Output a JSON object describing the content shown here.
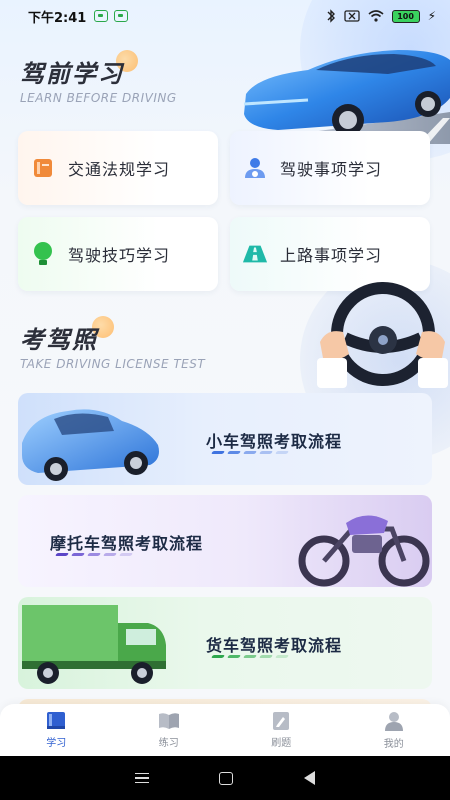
{
  "status_bar": {
    "time": "下午2:41",
    "battery": "100"
  },
  "learn_section": {
    "title": "驾前学习",
    "subtitle": "LEARN BEFORE DRIVING",
    "items": [
      {
        "label": "交通法规学习",
        "icon": "book-icon",
        "color": "#f08a3a"
      },
      {
        "label": "驾驶事项学习",
        "icon": "driver-icon",
        "color": "#3f7be8"
      },
      {
        "label": "驾驶技巧学习",
        "icon": "bulb-icon",
        "color": "#34c24e"
      },
      {
        "label": "上路事项学习",
        "icon": "road-icon",
        "color": "#1fb9a8"
      }
    ]
  },
  "license_section": {
    "title": "考驾照",
    "subtitle": "TAKE DRIVING LICENSE TEST",
    "processes": [
      {
        "label": "小车驾照考取流程",
        "accent": "#3f73e0"
      },
      {
        "label": "摩托车驾照考取流程",
        "accent": "#7b5ce0"
      },
      {
        "label": "货车驾照考取流程",
        "accent": "#35b85a"
      }
    ]
  },
  "tab_bar": {
    "tabs": [
      {
        "label": "学习",
        "icon": "study-book-icon",
        "active": true
      },
      {
        "label": "练习",
        "icon": "open-book-icon",
        "active": false
      },
      {
        "label": "刷题",
        "icon": "edit-doc-icon",
        "active": false
      },
      {
        "label": "我的",
        "icon": "profile-icon",
        "active": false
      }
    ]
  },
  "colors": {
    "accent": "#2f5fd0",
    "inactive_tab": "#8a8f99"
  }
}
